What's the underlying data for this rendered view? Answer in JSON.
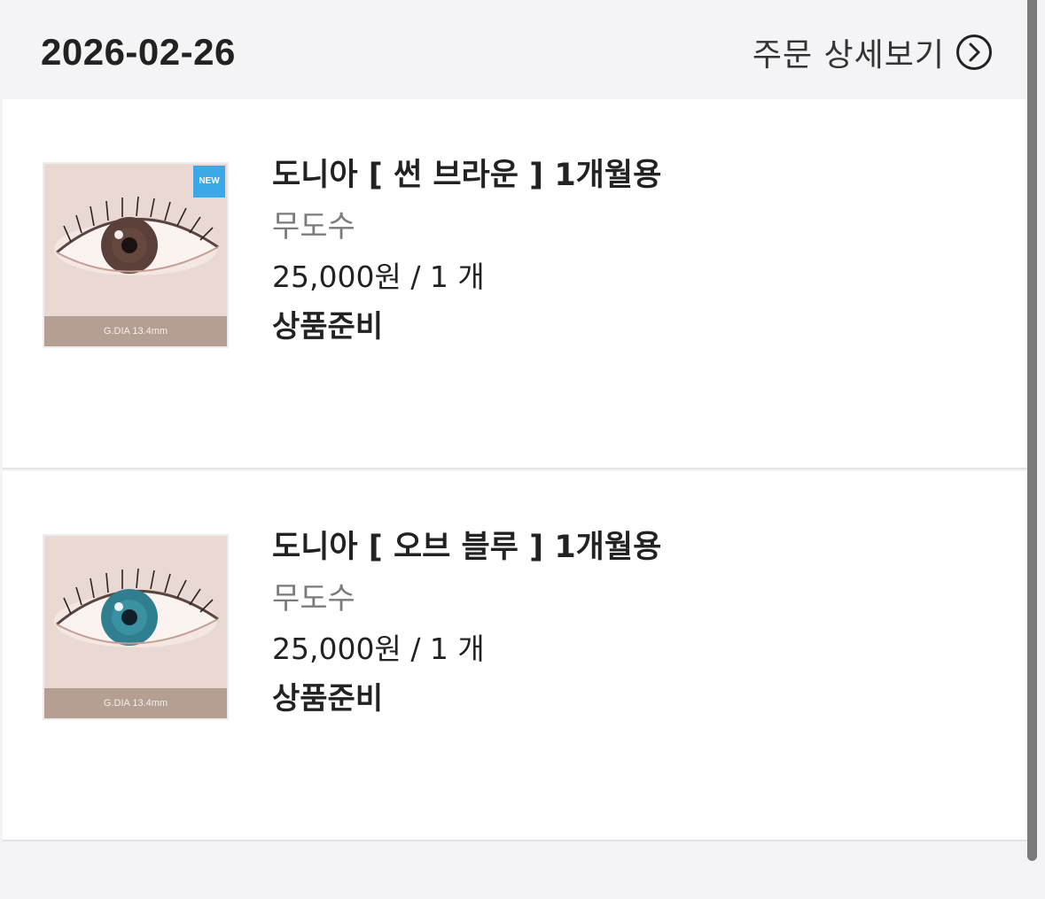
{
  "header": {
    "date": "2026-02-26",
    "detail_label": "주문 상세보기",
    "detail_icon": "chevron-right-circle-icon"
  },
  "items": [
    {
      "name": "도니아 [ 썬 브라운 ] 1개월용",
      "option": "무도수",
      "price": "25,000원 / 1 개",
      "status": "상품준비",
      "badge": "NEW",
      "dia_text": "G.DIA 13.4mm",
      "lens_color": "#5a4038"
    },
    {
      "name": "도니아 [ 오브 블루 ] 1개월용",
      "option": "무도수",
      "price": "25,000원 / 1 개",
      "status": "상품준비",
      "dia_text": "G.DIA 13.4mm",
      "lens_color": "#2f7f90"
    }
  ]
}
